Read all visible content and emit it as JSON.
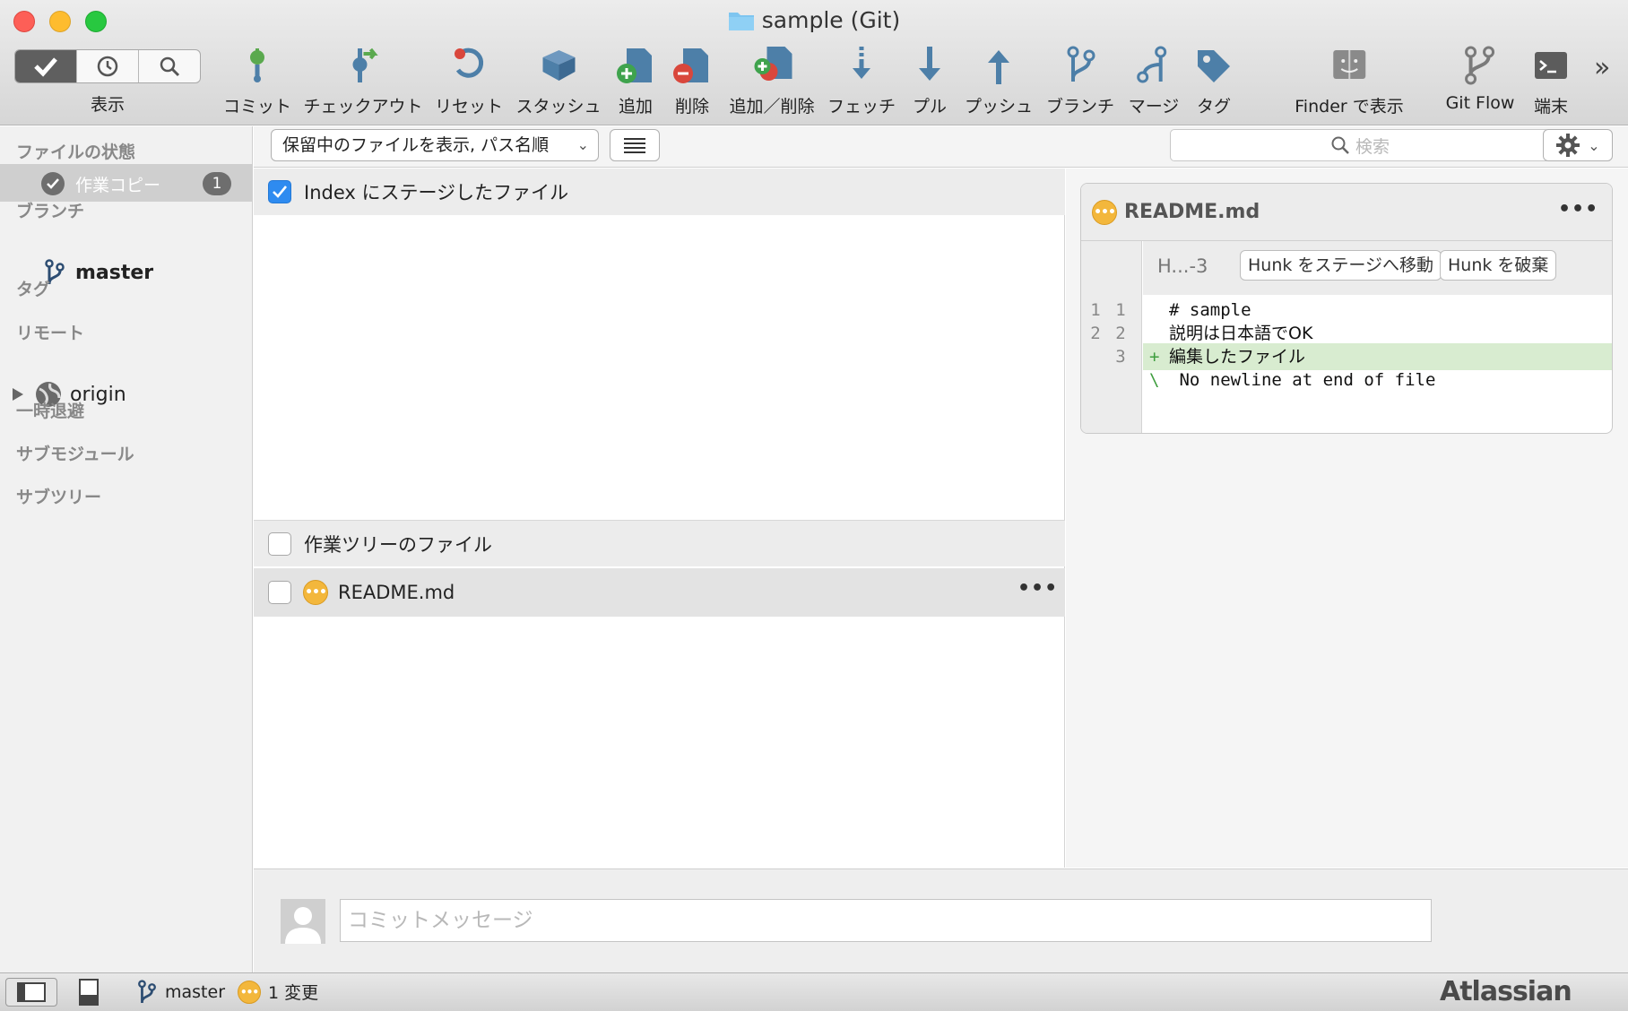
{
  "window": {
    "title": "sample (Git)"
  },
  "toolbar": {
    "view_label": "表示",
    "items": [
      {
        "label": "コミット",
        "icon": "commit-icon"
      },
      {
        "label": "チェックアウト",
        "icon": "checkout-icon"
      },
      {
        "label": "リセット",
        "icon": "reset-icon"
      },
      {
        "label": "スタッシュ",
        "icon": "stash-icon"
      },
      {
        "label": "追加",
        "icon": "add-icon"
      },
      {
        "label": "削除",
        "icon": "remove-icon"
      },
      {
        "label": "追加／削除",
        "icon": "add-remove-icon"
      },
      {
        "label": "フェッチ",
        "icon": "fetch-icon"
      },
      {
        "label": "プル",
        "icon": "pull-icon"
      },
      {
        "label": "プッシュ",
        "icon": "push-icon"
      },
      {
        "label": "ブランチ",
        "icon": "branch-icon"
      },
      {
        "label": "マージ",
        "icon": "merge-icon"
      },
      {
        "label": "タグ",
        "icon": "tag-icon"
      },
      {
        "label": "Finder で表示",
        "icon": "finder-icon"
      },
      {
        "label": "Git Flow",
        "icon": "git-flow-icon"
      },
      {
        "label": "端末",
        "icon": "terminal-icon"
      }
    ],
    "more": "»"
  },
  "sidebar": {
    "file_status_header": "ファイルの状態",
    "working_copy": {
      "label": "作業コピー",
      "count": "1"
    },
    "branches_header": "ブランチ",
    "branches": [
      {
        "name": "master"
      }
    ],
    "tags_header": "タグ",
    "remotes_header": "リモート",
    "remotes": [
      {
        "name": "origin"
      }
    ],
    "stashes_header": "一時退避",
    "submodules_header": "サブモジュール",
    "subtrees_header": "サブツリー"
  },
  "filterbar": {
    "filter_value": "保留中のファイルを表示, パス名順",
    "search_placeholder": "検索"
  },
  "filelist": {
    "staged_header": "Index にステージしたファイル",
    "unstaged_header": "作業ツリーのファイル",
    "files": [
      {
        "name": "README.md",
        "status": "modified"
      }
    ]
  },
  "diff": {
    "filename": "README.md",
    "hunk_range": "H...-3",
    "stage_hunk_label": "Hunk をステージへ移動",
    "discard_hunk_label": "Hunk を破棄",
    "lines": [
      {
        "old": "1",
        "new": "1",
        "marker": "",
        "text": "# sample",
        "type": "context"
      },
      {
        "old": "2",
        "new": "2",
        "marker": "",
        "text": "説明は日本語でOK",
        "type": "context"
      },
      {
        "old": "",
        "new": "3",
        "marker": "+",
        "text": "編集したファイル",
        "type": "added"
      },
      {
        "old": "",
        "new": "",
        "marker": "\\",
        "text": " No newline at end of file",
        "type": "note"
      }
    ]
  },
  "commit": {
    "placeholder": "コミットメッセージ"
  },
  "statusbar": {
    "branch": "master",
    "changes": "1 変更",
    "brand": "Atlassian"
  },
  "colors": {
    "accent": "#2e8bf0",
    "modified": "#f3b73c",
    "added_bg": "#d8ecd0",
    "toolbar_icon": "#4d7fa8"
  }
}
